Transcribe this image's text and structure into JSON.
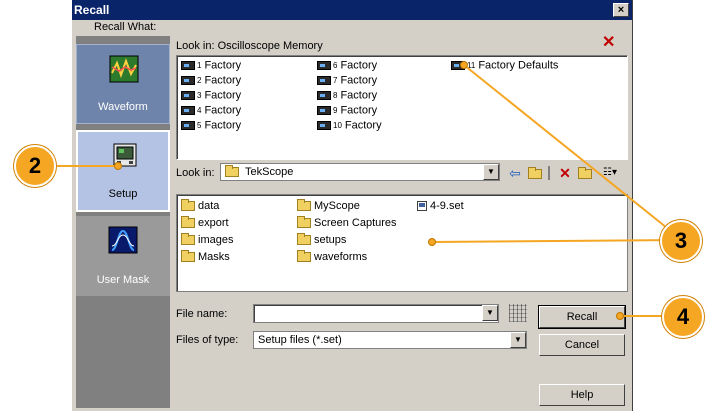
{
  "window": {
    "title": "Recall",
    "close_glyph": "×"
  },
  "recall_what_label": "Recall What:",
  "categories": [
    {
      "label": "Waveform",
      "icon": "waveform-icon"
    },
    {
      "label": "Setup",
      "icon": "setup-icon"
    },
    {
      "label": "User Mask",
      "icon": "user-mask-icon"
    }
  ],
  "memory": {
    "look_in": "Look in: Oscilloscope Memory",
    "items": [
      {
        "num": "1",
        "label": "Factory"
      },
      {
        "num": "2",
        "label": "Factory"
      },
      {
        "num": "3",
        "label": "Factory"
      },
      {
        "num": "4",
        "label": "Factory"
      },
      {
        "num": "5",
        "label": "Factory"
      },
      {
        "num": "6",
        "label": "Factory"
      },
      {
        "num": "7",
        "label": "Factory"
      },
      {
        "num": "8",
        "label": "Factory"
      },
      {
        "num": "9",
        "label": "Factory"
      },
      {
        "num": "10",
        "label": "Factory"
      },
      {
        "num": "11",
        "label": "Factory Defaults"
      }
    ]
  },
  "browser": {
    "look_in_label": "Look in:",
    "look_in_value": "TekScope",
    "folders": [
      "data",
      "export",
      "images",
      "Masks",
      "MyScope",
      "Screen Captures",
      "setups",
      "waveforms"
    ],
    "files": [
      "4-9.set"
    ]
  },
  "file_name_label": "File name:",
  "file_name_value": "",
  "file_type_label": "Files of type:",
  "file_type_value": "Setup files (*.set)",
  "buttons": {
    "recall": "Recall",
    "cancel": "Cancel",
    "help": "Help"
  },
  "callouts": [
    "2",
    "3",
    "4"
  ],
  "colors": {
    "title_bar": "#0a246a",
    "callout": "#f5a623",
    "selected_category": "#b4c3e3"
  }
}
